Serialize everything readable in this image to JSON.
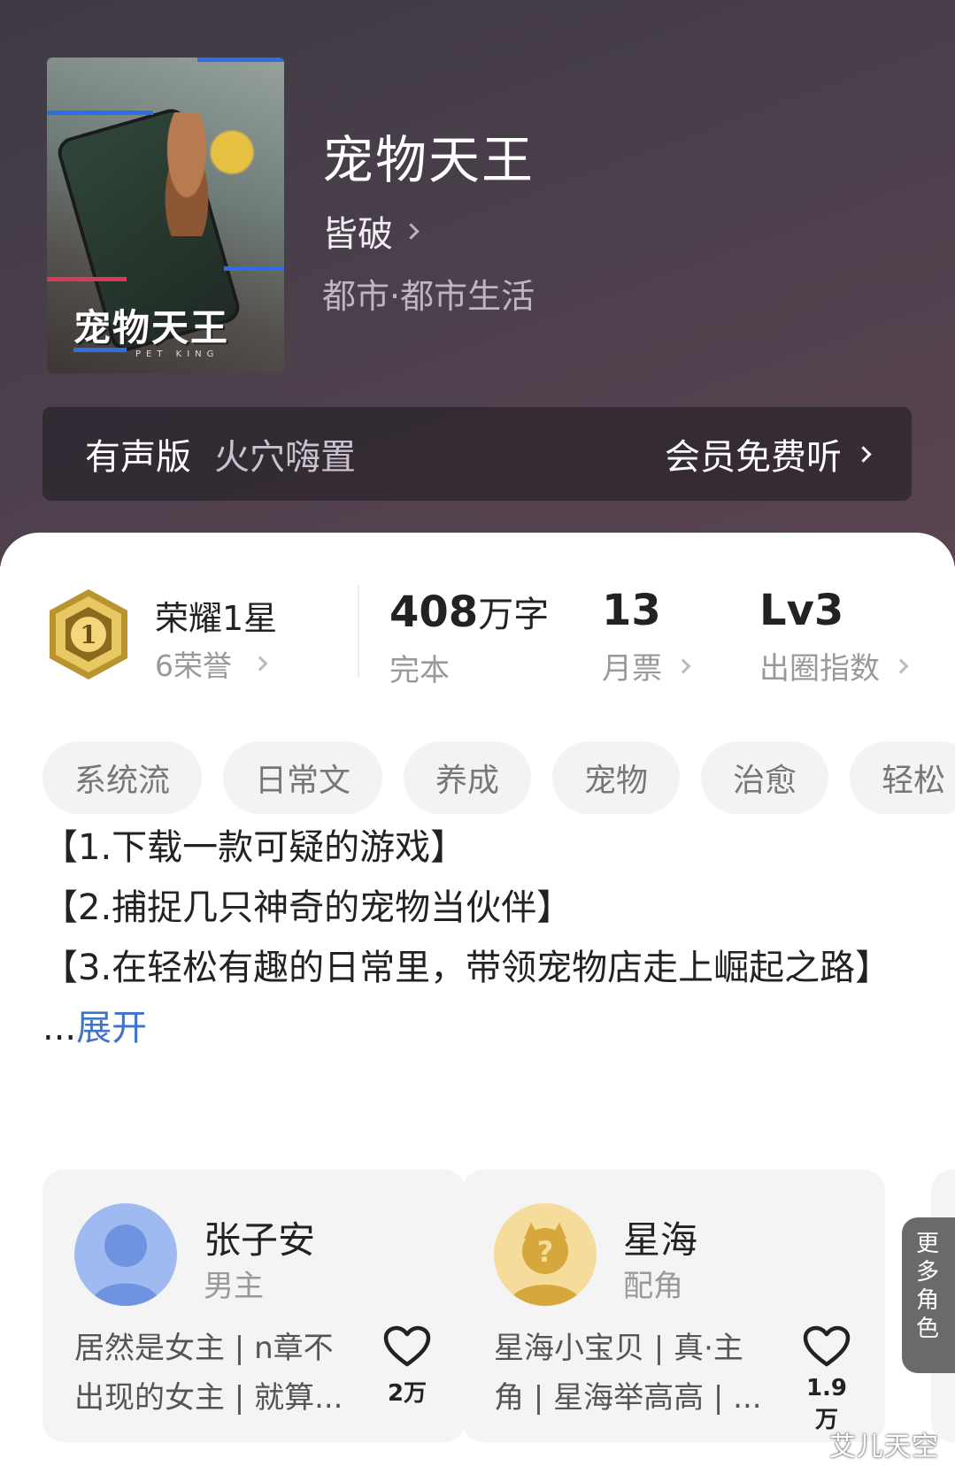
{
  "book": {
    "title": "宠物天王",
    "author": "皆破",
    "genre": "都市·都市生活",
    "cover_title": "宠物天王",
    "cover_subtitle": "PET KING"
  },
  "audio": {
    "label": "有声版",
    "narrator": "火穴嗨置",
    "cta": "会员免费听"
  },
  "honor": {
    "badge_number": "1",
    "title": "荣耀1星",
    "subtitle": "6荣誉"
  },
  "stats": [
    {
      "value": "408",
      "unit": "万字",
      "caption": "完本"
    },
    {
      "value": "13",
      "unit": "",
      "caption": "月票"
    },
    {
      "value": "Lv3",
      "unit": "",
      "caption": "出圈指数"
    }
  ],
  "tags": [
    "系统流",
    "日常文",
    "养成",
    "宠物",
    "治愈",
    "轻松"
  ],
  "intro": {
    "line1": "【1.下载一款可疑的游戏】",
    "line2": "【2.捕捉几只神奇的宠物当伙伴】",
    "line3": "【3.在轻松有趣的日常里，带领宠物店走上崛起之路】",
    "ellipsis": "...",
    "expand": "展开"
  },
  "characters": [
    {
      "name": "张子安",
      "role": "男主",
      "desc": "居然是女主 | n章不出现的女主 | 就算...",
      "likes": "2万"
    },
    {
      "name": "星海",
      "role": "配角",
      "desc": "星海小宝贝 | 真·主角 | 星海举高高 | ...",
      "likes": "1.9万"
    }
  ],
  "more_roles": "更多角色",
  "watermark": "艾儿天空",
  "colors": {
    "header_bg": "#4a3f4b",
    "accent_link": "#3f73c8",
    "badge_gold": "#c9a53c"
  }
}
